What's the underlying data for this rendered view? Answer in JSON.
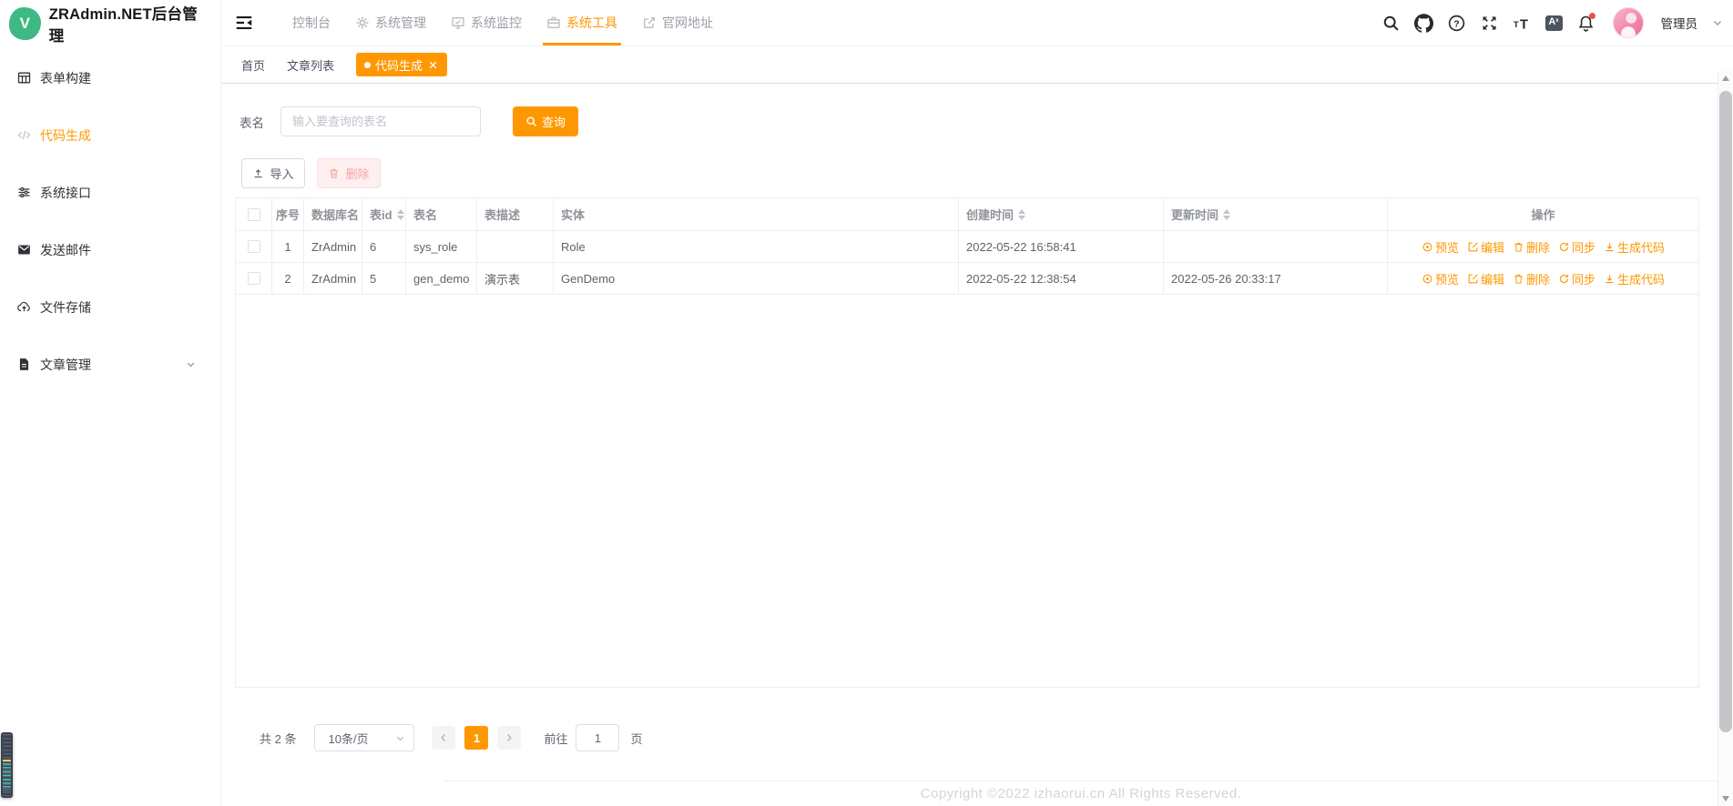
{
  "app": {
    "title": "ZRAdmin.NET后台管理",
    "logo_letter": "V"
  },
  "sidebar": {
    "items": [
      {
        "label": "表单构建",
        "icon": "form-grid-icon",
        "active": false
      },
      {
        "label": "代码生成",
        "icon": "code-icon",
        "active": true
      },
      {
        "label": "系统接口",
        "icon": "sliders-icon",
        "active": false
      },
      {
        "label": "发送邮件",
        "icon": "mail-icon",
        "active": false
      },
      {
        "label": "文件存储",
        "icon": "cloud-upload-icon",
        "active": false
      },
      {
        "label": "文章管理",
        "icon": "document-icon",
        "active": false,
        "expandable": true
      }
    ]
  },
  "topnav": {
    "items": [
      {
        "label": "控制台",
        "icon": null,
        "active": false
      },
      {
        "label": "系统管理",
        "icon": "gear-icon",
        "active": false
      },
      {
        "label": "系统监控",
        "icon": "monitor-icon",
        "active": false
      },
      {
        "label": "系统工具",
        "icon": "briefcase-icon",
        "active": true
      },
      {
        "label": "官网地址",
        "icon": "external-link-icon",
        "active": false
      }
    ]
  },
  "user": {
    "name": "管理员"
  },
  "tabs": [
    {
      "label": "首页",
      "active": false,
      "closable": false
    },
    {
      "label": "文章列表",
      "active": false,
      "closable": false
    },
    {
      "label": "代码生成",
      "active": true,
      "closable": true
    }
  ],
  "query_form": {
    "label": "表名",
    "placeholder": "输入要查询的表名",
    "search_button": "查询"
  },
  "toolbar": {
    "import_button": "导入",
    "delete_button": "删除"
  },
  "table": {
    "columns": [
      {
        "label": "序号",
        "sortable": false
      },
      {
        "label": "数据库名",
        "sortable": false
      },
      {
        "label": "表id",
        "sortable": true
      },
      {
        "label": "表名",
        "sortable": false
      },
      {
        "label": "表描述",
        "sortable": false
      },
      {
        "label": "实体",
        "sortable": false
      },
      {
        "label": "创建时间",
        "sortable": true
      },
      {
        "label": "更新时间",
        "sortable": true
      },
      {
        "label": "操作",
        "sortable": false
      }
    ],
    "rows": [
      {
        "seq": "1",
        "db_name": "ZrAdmin",
        "table_id": "6",
        "table_name": "sys_role",
        "description": "",
        "entity": "Role",
        "created_at": "2022-05-22 16:58:41",
        "updated_at": ""
      },
      {
        "seq": "2",
        "db_name": "ZrAdmin",
        "table_id": "5",
        "table_name": "gen_demo",
        "description": "演示表",
        "entity": "GenDemo",
        "created_at": "2022-05-22 12:38:54",
        "updated_at": "2022-05-26 20:33:17"
      }
    ],
    "actions": [
      {
        "label": "预览",
        "icon": "eye-icon"
      },
      {
        "label": "编辑",
        "icon": "edit-icon"
      },
      {
        "label": "删除",
        "icon": "trash-icon"
      },
      {
        "label": "同步",
        "icon": "sync-icon"
      },
      {
        "label": "生成代码",
        "icon": "download-icon"
      }
    ]
  },
  "pagination": {
    "total": "共 2 条",
    "page_size": "10条/页",
    "current_page": "1",
    "goto_label": "前往",
    "goto_value": "1",
    "goto_suffix": "页"
  },
  "footer": {
    "copyright": "Copyright ©2022 izhaorui.cn All Rights Reserved."
  },
  "colors": {
    "accent": "#ff9800",
    "logo_green": "#3eb983",
    "danger_bg": "#fef0f0",
    "danger_text": "#f5a6a6",
    "table_border": "#ebeef5",
    "header_text": "#8f9399",
    "cell_text": "#5f6368",
    "notification_dot": "#f34d4d"
  }
}
